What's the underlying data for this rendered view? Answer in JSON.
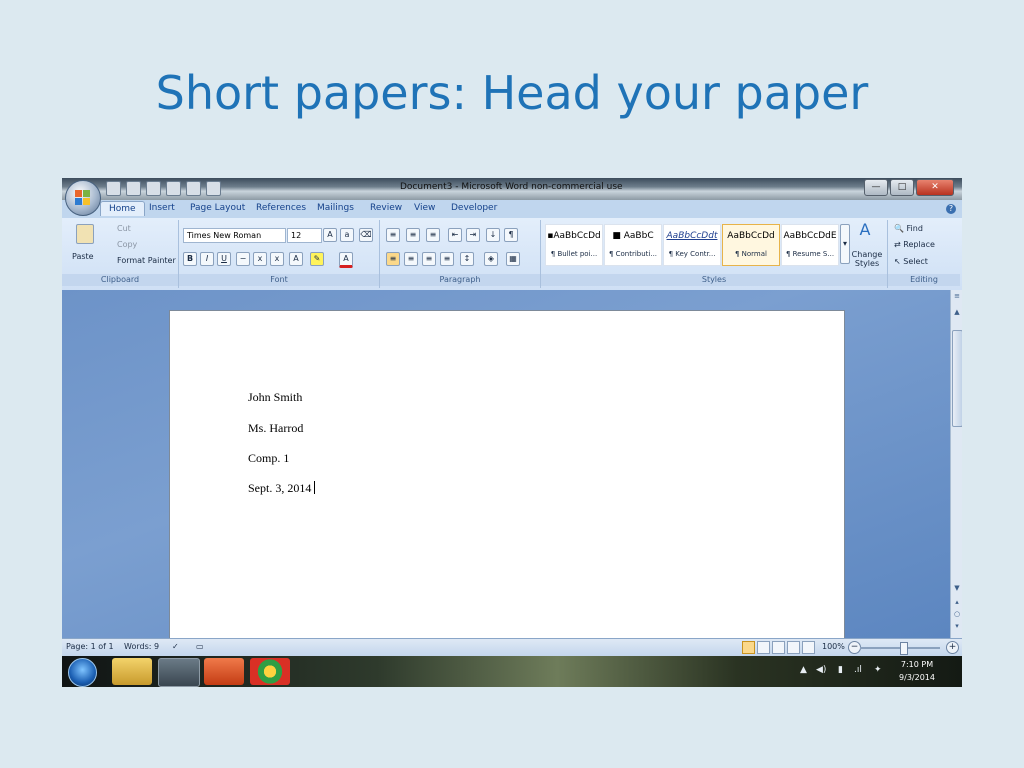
{
  "slide": {
    "title": "Short papers: Head your paper"
  },
  "window": {
    "title": "Document3 - Microsoft Word non-commercial use",
    "controls": {
      "minimize": "—",
      "maximize": "□",
      "close": "✕"
    }
  },
  "tabs": [
    {
      "label": "Home"
    },
    {
      "label": "Insert"
    },
    {
      "label": "Page Layout"
    },
    {
      "label": "References"
    },
    {
      "label": "Mailings"
    },
    {
      "label": "Review"
    },
    {
      "label": "View"
    },
    {
      "label": "Developer"
    }
  ],
  "clipboard": {
    "paste": "Paste",
    "cut": "Cut",
    "copy": "Copy",
    "format_painter": "Format Painter",
    "label": "Clipboard"
  },
  "font": {
    "name": "Times New Roman",
    "size": "12",
    "label": "Font"
  },
  "paragraph": {
    "label": "Paragraph"
  },
  "styles": {
    "label": "Styles",
    "items": [
      {
        "sample": "▪AaBbCcDd",
        "name": "¶ Bullet poi..."
      },
      {
        "sample": "■  AaBbC",
        "name": "¶ Contributi..."
      },
      {
        "sample": "AaBbCcDdt",
        "name": "¶ Key Contr..."
      },
      {
        "sample": "AaBbCcDd",
        "name": "¶ Normal"
      },
      {
        "sample": "AaBbCcDdE",
        "name": "¶ Resume S..."
      }
    ],
    "change": "Change Styles"
  },
  "editing": {
    "find": "Find",
    "replace": "Replace",
    "select": "Select",
    "label": "Editing"
  },
  "document": {
    "lines": [
      "John Smith",
      "Ms. Harrod",
      "Comp. 1",
      "Sept. 3, 2014"
    ]
  },
  "status": {
    "page": "Page: 1 of 1",
    "words": "Words: 9",
    "zoom": "100%"
  },
  "taskbar": {
    "time": "7:10 PM",
    "date": "9/3/2014"
  },
  "colors": {
    "title_blue": "#1f73b7",
    "ribbon_bg": "#dbe8f8",
    "workspace_blue": "#6d93c8",
    "selected_style": "#e7b34a"
  }
}
